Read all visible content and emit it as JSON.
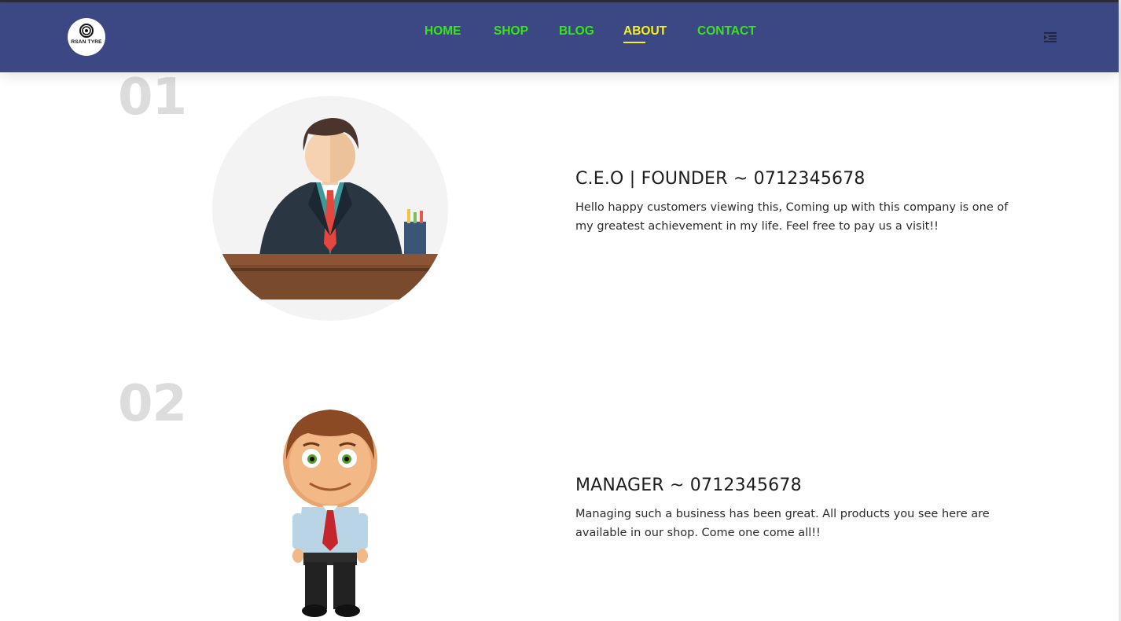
{
  "header": {
    "logo_text": "RSAN TYRE",
    "nav": [
      {
        "label": "HOME",
        "active": false
      },
      {
        "label": "SHOP",
        "active": false
      },
      {
        "label": "BLOG",
        "active": false
      },
      {
        "label": "ABOUT",
        "active": true
      },
      {
        "label": "CONTACT",
        "active": false
      }
    ],
    "menu_icon": "indent-menu-icon",
    "colors": {
      "bar": "#3b4883",
      "link": "#39e51a",
      "active_link": "#f7f31a"
    }
  },
  "team": [
    {
      "number": "01",
      "title": "C.E.O | FOUNDER ~ 0712345678",
      "description": "Hello happy customers viewing this, Coming up with this company is one of my greatest achievement in my life. Feel free to pay us a visit!!",
      "illustration": "ceo-at-desk-illustration"
    },
    {
      "number": "02",
      "title": "MANAGER ~ 0712345678",
      "description": "Managing such a business has been great. All products you see here are available in our shop. Come one come all!!",
      "illustration": "manager-cartoon-illustration"
    }
  ]
}
